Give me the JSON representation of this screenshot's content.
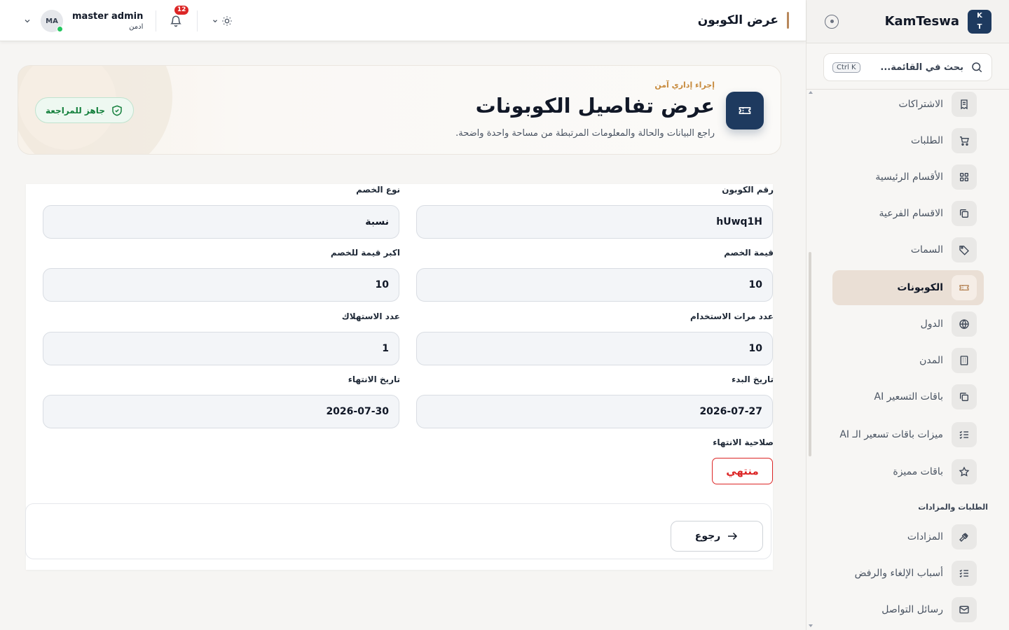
{
  "app": {
    "brand_name": "KamTeswa",
    "brand_logo": [
      "K",
      "T"
    ]
  },
  "sidebar": {
    "search_placeholder": "بحث في القائمة...",
    "search_shortcut": "Ctrl K",
    "items": [
      {
        "label": "الاشتراكات",
        "icon": "receipt-icon"
      },
      {
        "label": "الطلبات",
        "icon": "cart-icon"
      },
      {
        "label": "الأقسام الرئيسية",
        "icon": "grid-icon"
      },
      {
        "label": "الاقسام الفرعية",
        "icon": "copy-icon"
      },
      {
        "label": "السمات",
        "icon": "tag-icon"
      },
      {
        "label": "الكوبونات",
        "icon": "ticket-icon",
        "active": true
      },
      {
        "label": "الدول",
        "icon": "globe-icon"
      },
      {
        "label": "المدن",
        "icon": "building-icon"
      },
      {
        "label": "باقات التسعير AI",
        "icon": "copy-icon"
      },
      {
        "label": "ميزات باقات تسعير الـ AI",
        "icon": "list-check-icon"
      },
      {
        "label": "باقات مميزة",
        "icon": "star-icon"
      }
    ],
    "section_title": "الطلبات والمزادات",
    "section_items": [
      {
        "label": "المزادات",
        "icon": "gavel-icon"
      },
      {
        "label": "أسباب الإلغاء والرفض",
        "icon": "list-check-icon"
      },
      {
        "label": "رسائل التواصل",
        "icon": "mail-icon"
      }
    ]
  },
  "header": {
    "title": "عرض الكوبون",
    "user_name": "master admin",
    "user_role": "ادمن",
    "user_initials": "MA",
    "notification_count": "12"
  },
  "hero": {
    "kicker": "إجراء إداري آمن",
    "title": "عرض تفاصيل الكوبونات",
    "subtitle": "راجع البيانات والحالة والمعلومات المرتبطة من مساحة واحدة واضحة.",
    "badge": "جاهز للمراجعة"
  },
  "form": {
    "fields": [
      {
        "label": "رقم الكوبون",
        "value": "hUwq1H"
      },
      {
        "label": "نوع الخصم",
        "value": "نسبة"
      },
      {
        "label": "قيمة الخصم",
        "value": "10"
      },
      {
        "label": "اكبر قيمة للخصم",
        "value": "10"
      },
      {
        "label": "عدد مرات الاستخدام",
        "value": "10"
      },
      {
        "label": "عدد الاستهلاك",
        "value": "1"
      },
      {
        "label": "تاريخ البدء",
        "value": "2026-07-27"
      },
      {
        "label": "تاريخ الانتهاء",
        "value": "2026-07-30"
      }
    ],
    "expiry_label": "صلاحية الانتهاء",
    "expiry_status": "منتهي",
    "expiry_status_color": "#dc2626",
    "back_label": "رجوع"
  },
  "colors": {
    "primary": "#1e3a5f",
    "accent": "#b8885c",
    "success": "#15803d",
    "danger": "#dc2626"
  }
}
